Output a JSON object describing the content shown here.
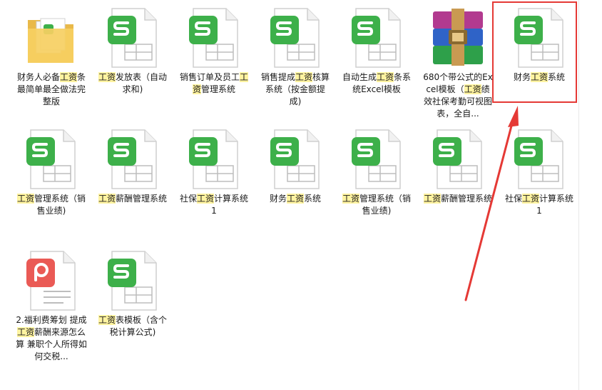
{
  "files": [
    {
      "icon": "folder-icon",
      "label": [
        {
          "t": "财务人必备"
        },
        {
          "t": "工资",
          "h": true
        },
        {
          "t": "条最简单最全做法完整版"
        }
      ]
    },
    {
      "icon": "spreadsheet-icon",
      "label": [
        {
          "t": "工资",
          "h": true
        },
        {
          "t": "发放表（自动求和)"
        }
      ]
    },
    {
      "icon": "spreadsheet-icon",
      "label": [
        {
          "t": "销售订单及员工"
        },
        {
          "t": "工资",
          "h": true
        },
        {
          "t": "管理系统"
        }
      ]
    },
    {
      "icon": "spreadsheet-icon",
      "label": [
        {
          "t": "销售提成"
        },
        {
          "t": "工资",
          "h": true
        },
        {
          "t": "核算系统（按金额提成)"
        }
      ]
    },
    {
      "icon": "spreadsheet-icon",
      "label": [
        {
          "t": "自动生成"
        },
        {
          "t": "工资",
          "h": true
        },
        {
          "t": "条系统Excel模板"
        }
      ]
    },
    {
      "icon": "archive-icon",
      "label": [
        {
          "t": "680个带公式的Excel模板（"
        },
        {
          "t": "工资",
          "h": true
        },
        {
          "t": "绩效社保考勤可视图表，全自..."
        }
      ]
    },
    {
      "icon": "spreadsheet-icon",
      "label": [
        {
          "t": "财务"
        },
        {
          "t": "工资",
          "h": true
        },
        {
          "t": "系统"
        }
      ]
    },
    {
      "icon": "spreadsheet-icon",
      "label": [
        {
          "t": "工资",
          "h": true
        },
        {
          "t": "管理系统（销售业绩)"
        }
      ]
    },
    {
      "icon": "spreadsheet-icon",
      "label": [
        {
          "t": "工资",
          "h": true
        },
        {
          "t": "薪酬管理系统"
        }
      ]
    },
    {
      "icon": "spreadsheet-icon",
      "label": [
        {
          "t": "社保"
        },
        {
          "t": "工资",
          "h": true
        },
        {
          "t": "计算系统1"
        }
      ]
    },
    {
      "icon": "spreadsheet-icon",
      "label": [
        {
          "t": "财务"
        },
        {
          "t": "工资",
          "h": true
        },
        {
          "t": "系统"
        }
      ]
    },
    {
      "icon": "spreadsheet-icon",
      "label": [
        {
          "t": "工资",
          "h": true
        },
        {
          "t": "管理系统（销售业绩)"
        }
      ]
    },
    {
      "icon": "spreadsheet-icon",
      "label": [
        {
          "t": "工资",
          "h": true
        },
        {
          "t": "薪酬管理系统"
        }
      ]
    },
    {
      "icon": "spreadsheet-icon",
      "label": [
        {
          "t": "社保"
        },
        {
          "t": "工资",
          "h": true
        },
        {
          "t": "计算系统1"
        }
      ]
    },
    {
      "icon": "presentation-icon",
      "label": [
        {
          "t": "2.福利费筹划 提成"
        },
        {
          "t": "工资",
          "h": true
        },
        {
          "t": "薪酬来源怎么算 兼职个人所得如何交税..."
        }
      ]
    },
    {
      "icon": "spreadsheet-icon",
      "label": [
        {
          "t": "工资",
          "h": true
        },
        {
          "t": "表模板（含个税计算公式)"
        }
      ]
    }
  ],
  "colors": {
    "spreadsheet_green": "#3db04a",
    "presentation_red": "#ea5a55",
    "highlight": "#fff3a0",
    "annotation_red": "#e53935"
  },
  "selected_index": 6
}
